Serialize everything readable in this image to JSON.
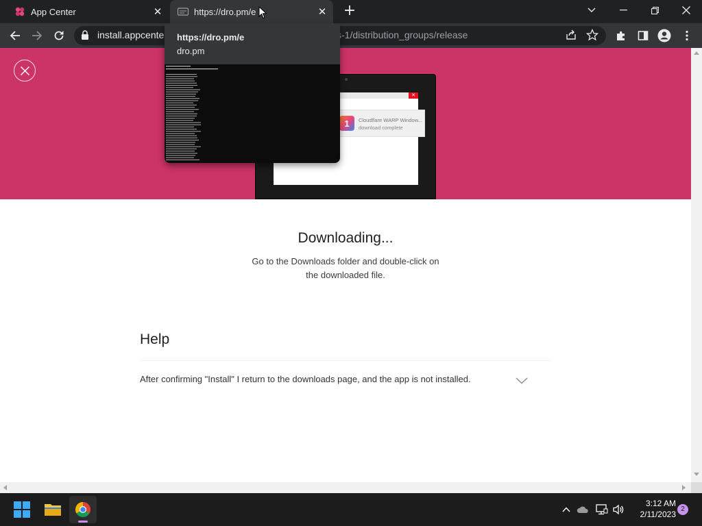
{
  "browser": {
    "tabs": [
      {
        "title": "App Center",
        "favicon": "app-center-icon",
        "state": "active"
      },
      {
        "title": "https://dro.pm/e",
        "favicon": "page-icon",
        "state": "hovered"
      }
    ],
    "new_tab_glyph": "+",
    "address_bar": {
      "url_visible": "install.appcenter",
      "url_tail": "s-1/distribution_groups/release"
    },
    "hover_card": {
      "title": "https://dro.pm/e",
      "domain": "dro.pm"
    },
    "window_controls": [
      "tab-search",
      "minimize",
      "restore",
      "close"
    ]
  },
  "page": {
    "accent": "#cc3366",
    "hero": {
      "toast_title": "Cloudflare WARP Window...",
      "toast_subtitle": "download complete"
    },
    "download": {
      "title": "Downloading...",
      "description_line1": "Go to the Downloads folder and double-click on",
      "description_line2": "the downloaded file."
    },
    "help": {
      "title": "Help",
      "faq": [
        {
          "question": "After confirming \"Install\" I return to the downloads page, and the app is not installed."
        }
      ]
    }
  },
  "taskbar": {
    "apps": [
      "start-icon",
      "file-explorer-icon",
      "chrome-icon"
    ],
    "time": "3:12 AM",
    "date": "2/11/2023",
    "notification_count": "2"
  }
}
